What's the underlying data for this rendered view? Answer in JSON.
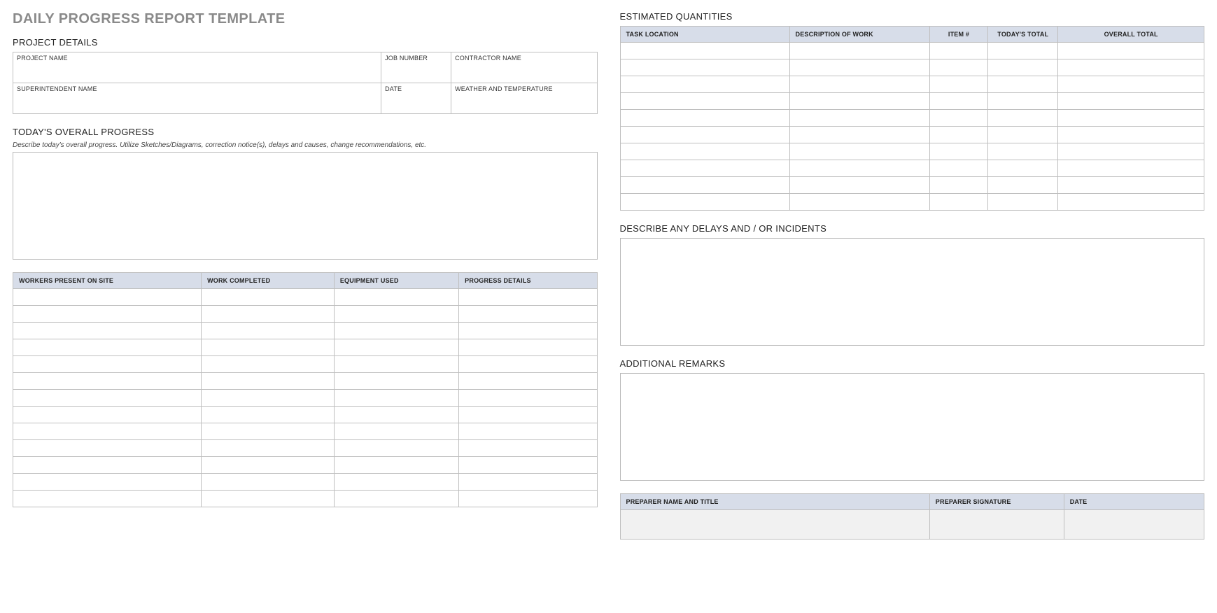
{
  "title": "DAILY PROGRESS REPORT TEMPLATE",
  "left": {
    "projectDetails": {
      "heading": "PROJECT DETAILS",
      "labels": {
        "projectName": "PROJECT NAME",
        "jobNumber": "JOB NUMBER",
        "contractor": "CONTRACTOR NAME",
        "superintendent": "SUPERINTENDENT NAME",
        "date": "DATE",
        "weather": "WEATHER AND TEMPERATURE"
      },
      "values": {
        "projectName": "",
        "jobNumber": "",
        "contractor": "",
        "superintendent": "",
        "date": "",
        "weather": ""
      }
    },
    "overallProgress": {
      "heading": "TODAY'S OVERALL PROGRESS",
      "instruction": "Describe today's overall progress.  Utilize Sketches/Diagrams, correction notice(s), delays and causes, change recommendations, etc.",
      "value": ""
    },
    "workTable": {
      "headers": {
        "workers": "WORKERS PRESENT ON SITE",
        "completed": "WORK COMPLETED",
        "equipment": "EQUIPMENT USED",
        "details": "PROGRESS DETAILS"
      },
      "rows": [
        {
          "workers": "",
          "completed": "",
          "equipment": "",
          "details": ""
        },
        {
          "workers": "",
          "completed": "",
          "equipment": "",
          "details": ""
        },
        {
          "workers": "",
          "completed": "",
          "equipment": "",
          "details": ""
        },
        {
          "workers": "",
          "completed": "",
          "equipment": "",
          "details": ""
        },
        {
          "workers": "",
          "completed": "",
          "equipment": "",
          "details": ""
        },
        {
          "workers": "",
          "completed": "",
          "equipment": "",
          "details": ""
        },
        {
          "workers": "",
          "completed": "",
          "equipment": "",
          "details": ""
        },
        {
          "workers": "",
          "completed": "",
          "equipment": "",
          "details": ""
        },
        {
          "workers": "",
          "completed": "",
          "equipment": "",
          "details": ""
        },
        {
          "workers": "",
          "completed": "",
          "equipment": "",
          "details": ""
        },
        {
          "workers": "",
          "completed": "",
          "equipment": "",
          "details": ""
        },
        {
          "workers": "",
          "completed": "",
          "equipment": "",
          "details": ""
        },
        {
          "workers": "",
          "completed": "",
          "equipment": "",
          "details": ""
        }
      ]
    }
  },
  "right": {
    "estimatedQuantities": {
      "heading": "ESTIMATED QUANTITIES",
      "headers": {
        "taskLocation": "TASK LOCATION",
        "description": "DESCRIPTION OF WORK",
        "item": "ITEM #",
        "today": "TODAY'S TOTAL",
        "overall": "OVERALL TOTAL"
      },
      "rows": [
        {
          "taskLocation": "",
          "description": "",
          "item": "",
          "today": "",
          "overall": ""
        },
        {
          "taskLocation": "",
          "description": "",
          "item": "",
          "today": "",
          "overall": ""
        },
        {
          "taskLocation": "",
          "description": "",
          "item": "",
          "today": "",
          "overall": ""
        },
        {
          "taskLocation": "",
          "description": "",
          "item": "",
          "today": "",
          "overall": ""
        },
        {
          "taskLocation": "",
          "description": "",
          "item": "",
          "today": "",
          "overall": ""
        },
        {
          "taskLocation": "",
          "description": "",
          "item": "",
          "today": "",
          "overall": ""
        },
        {
          "taskLocation": "",
          "description": "",
          "item": "",
          "today": "",
          "overall": ""
        },
        {
          "taskLocation": "",
          "description": "",
          "item": "",
          "today": "",
          "overall": ""
        },
        {
          "taskLocation": "",
          "description": "",
          "item": "",
          "today": "",
          "overall": ""
        },
        {
          "taskLocation": "",
          "description": "",
          "item": "",
          "today": "",
          "overall": ""
        }
      ]
    },
    "delays": {
      "heading": "DESCRIBE ANY DELAYS AND / OR INCIDENTS",
      "value": ""
    },
    "remarks": {
      "heading": "ADDITIONAL REMARKS",
      "value": ""
    },
    "signature": {
      "headers": {
        "name": "PREPARER NAME AND TITLE",
        "sig": "PREPARER SIGNATURE",
        "date": "DATE"
      },
      "values": {
        "name": "",
        "sig": "",
        "date": ""
      }
    }
  }
}
